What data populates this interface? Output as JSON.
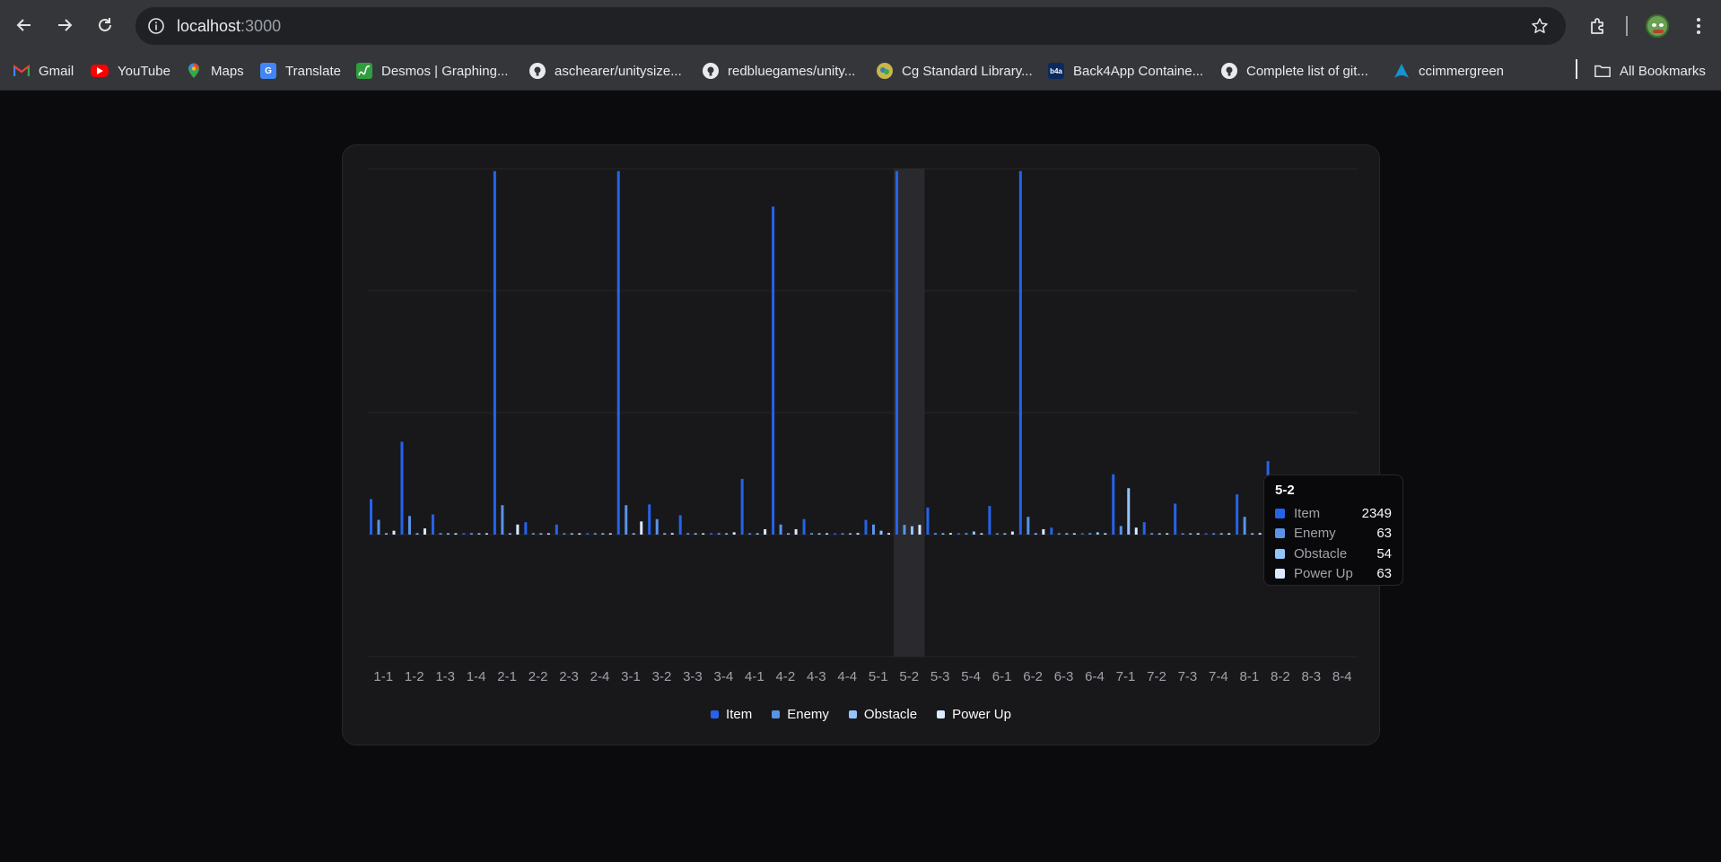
{
  "browser": {
    "url_host": "localhost",
    "url_port": ":3000",
    "bookmarks": [
      "Gmail",
      "YouTube",
      "Maps",
      "Translate",
      "Desmos | Graphing...",
      "aschearer/unitysize...",
      "redbluegames/unity...",
      "Cg Standard Library...",
      "Back4App Containe...",
      "Complete list of git...",
      "ccimmergreen"
    ],
    "all_bookmarks": "All Bookmarks"
  },
  "colors": {
    "item": "#2563eb",
    "enemy": "#5a93e6",
    "obstacle": "#93c5fd",
    "power_up": "#dbeafe",
    "card_bg": "#18181b",
    "page_bg": "#0b0b0d"
  },
  "tooltip": {
    "title": "5-2",
    "rows": [
      {
        "label": "Item",
        "value": "2349"
      },
      {
        "label": "Enemy",
        "value": "63"
      },
      {
        "label": "Obstacle",
        "value": "54"
      },
      {
        "label": "Power Up",
        "value": "63"
      }
    ]
  },
  "legend": [
    "Item",
    "Enemy",
    "Obstacle",
    "Power Up"
  ],
  "chart_data": {
    "type": "bar",
    "categories": [
      "1-1",
      "1-2",
      "1-3",
      "1-4",
      "2-1",
      "2-2",
      "2-3",
      "2-4",
      "3-1",
      "3-2",
      "3-3",
      "3-4",
      "4-1",
      "4-2",
      "4-3",
      "4-4",
      "5-1",
      "5-2",
      "5-3",
      "5-4",
      "6-1",
      "6-2",
      "6-3",
      "6-4",
      "7-1",
      "7-2",
      "7-3",
      "7-4",
      "8-1",
      "8-2",
      "8-3",
      "8-4"
    ],
    "series": [
      {
        "name": "Item",
        "values": [
          230,
          600,
          130,
          10,
          2349,
          80,
          65,
          10,
          2349,
          195,
          125,
          10,
          360,
          2120,
          100,
          5,
          95,
          2349,
          175,
          10,
          185,
          2349,
          45,
          10,
          390,
          80,
          200,
          5,
          260,
          475,
          95,
          10
        ]
      },
      {
        "name": "Enemy",
        "values": [
          95,
          120,
          10,
          10,
          190,
          10,
          5,
          10,
          190,
          100,
          10,
          10,
          5,
          65,
          10,
          5,
          65,
          63,
          10,
          10,
          5,
          115,
          5,
          10,
          55,
          10,
          5,
          5,
          115,
          70,
          25,
          25
        ]
      },
      {
        "name": "Obstacle",
        "values": [
          5,
          5,
          5,
          5,
          5,
          5,
          5,
          5,
          5,
          5,
          5,
          5,
          5,
          5,
          5,
          5,
          25,
          54,
          5,
          20,
          5,
          5,
          5,
          15,
          300,
          5,
          5,
          5,
          5,
          180,
          25,
          30
        ]
      },
      {
        "name": "Power Up",
        "values": [
          25,
          40,
          5,
          5,
          65,
          5,
          5,
          5,
          85,
          10,
          5,
          15,
          35,
          35,
          5,
          10,
          10,
          63,
          10,
          5,
          20,
          35,
          5,
          5,
          45,
          5,
          5,
          5,
          10,
          25,
          15,
          5
        ]
      }
    ],
    "ylim": [
      0,
      2400
    ],
    "grid": "horizontal",
    "legend_position": "bottom",
    "highlighted_category": "5-2"
  }
}
